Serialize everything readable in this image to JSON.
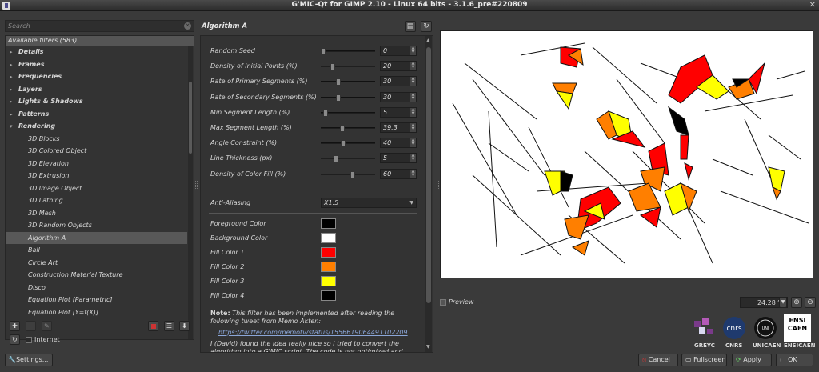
{
  "window": {
    "title": "G'MIC-Qt for GIMP 2.10 - Linux 64 bits - 3.1.6_pre#220809",
    "close_glyph": "✕"
  },
  "search": {
    "placeholder": "Search"
  },
  "filters": {
    "header": "Available filters (583)",
    "categories": [
      "Details",
      "Frames",
      "Frequencies",
      "Layers",
      "Lights & Shadows",
      "Patterns"
    ],
    "expanded_category": "Rendering",
    "items": [
      "3D Blocks",
      "3D Colored Object",
      "3D Elevation",
      "3D Extrusion",
      "3D Image Object",
      "3D Lathing",
      "3D Mesh",
      "3D Random Objects",
      "Algorithm A",
      "Ball",
      "Circle Art",
      "Construction Material Texture",
      "Disco",
      "Equation Plot [Parametric]",
      "Equation Plot [Y=f(X)]"
    ],
    "selected": "Algorithm A"
  },
  "internet_label": "Internet",
  "settings_label": "Settings...",
  "filter_title": "Algorithm A",
  "params": [
    {
      "label": "Random Seed",
      "value": "0",
      "fraction": 0.0
    },
    {
      "label": "Density of Initial Points (%)",
      "value": "20",
      "fraction": 0.2
    },
    {
      "label": "Rate of Primary Segments (%)",
      "value": "30",
      "fraction": 0.3
    },
    {
      "label": "Rate of Secondary Segments (%)",
      "value": "30",
      "fraction": 0.3
    },
    {
      "label": "Min Segment Length (%)",
      "value": "5",
      "fraction": 0.05
    },
    {
      "label": "Max Segment Length (%)",
      "value": "39.3",
      "fraction": 0.39
    },
    {
      "label": "Angle Constraint (%)",
      "value": "40",
      "fraction": 0.4
    },
    {
      "label": "Line Thickness (px)",
      "value": "5",
      "fraction": 0.25
    },
    {
      "label": "Density of Color Fill (%)",
      "value": "60",
      "fraction": 0.6
    }
  ],
  "antialias": {
    "label": "Anti-Aliasing",
    "value": "X1.5"
  },
  "colors": [
    {
      "label": "Foreground Color",
      "hex": "#000000"
    },
    {
      "label": "Background Color",
      "hex": "#ffffff"
    },
    {
      "label": "Fill Color 1",
      "hex": "#ff0000"
    },
    {
      "label": "Fill Color 2",
      "hex": "#ff7f00"
    },
    {
      "label": "Fill Color 3",
      "hex": "#ffff00"
    },
    {
      "label": "Fill Color 4",
      "hex": "#000000"
    }
  ],
  "note": {
    "bold": "Note:",
    "text": " This filter has been implemented after reading the following tweet from Memo Akten:",
    "link": "https://twitter.com/memotv/status/1556619064491102209",
    "text2": "I (David) found the idea really nice so I tried to convert the algorithm into a G'MIC script. The code is not optimized and"
  },
  "preview_label": "Preview",
  "zoom": "24.28 %",
  "logos": [
    "GREYC",
    "CNRS",
    "UNICAEN",
    "ENSICAEN"
  ],
  "buttons": {
    "cancel": "Cancel",
    "fullscreen": "Fullscreen",
    "apply": "Apply",
    "ok": "OK"
  }
}
